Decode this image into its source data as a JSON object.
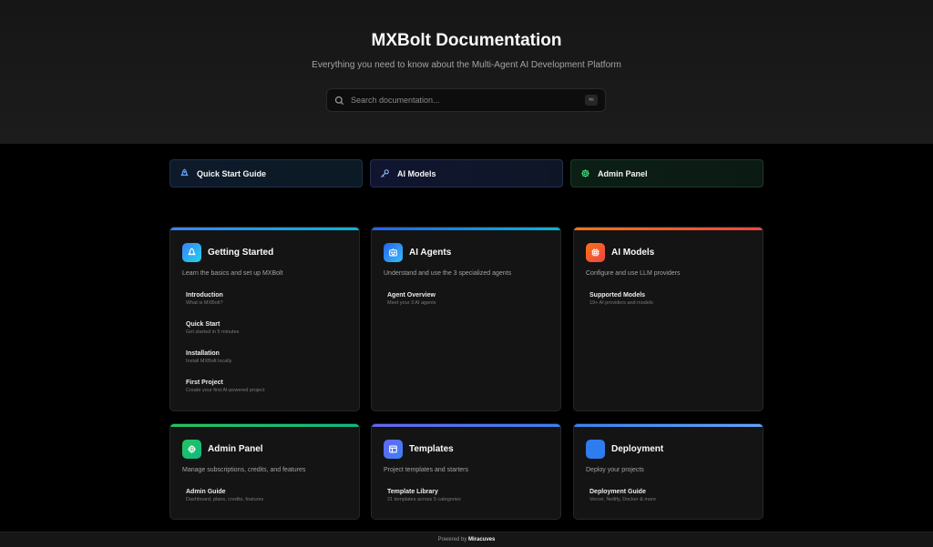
{
  "header": {
    "title": "MXBolt Documentation",
    "subtitle": "Everything you need to know about the Multi-Agent AI Development Platform"
  },
  "search": {
    "placeholder": "Search documentation...",
    "shortcut": "⌘K"
  },
  "quick_links": [
    {
      "label": "Quick Start Guide",
      "icon": "rocket-icon",
      "color": "#60a5fa"
    },
    {
      "label": "AI Models",
      "icon": "key-icon",
      "color": "#93c5fd"
    },
    {
      "label": "Admin Panel",
      "icon": "gear-icon",
      "color": "#4ade80"
    }
  ],
  "cards": [
    {
      "title": "Getting Started",
      "description": "Learn the basics and set up MXBolt",
      "icon": "rocket-icon",
      "accent": "#3b82f6",
      "items": [
        {
          "title": "Introduction",
          "subtitle": "What is MXBolt?"
        },
        {
          "title": "Quick Start",
          "subtitle": "Get started in 5 minutes"
        },
        {
          "title": "Installation",
          "subtitle": "Install MXBolt locally"
        },
        {
          "title": "First Project",
          "subtitle": "Create your first AI-powered project"
        }
      ]
    },
    {
      "title": "AI Agents",
      "description": "Understand and use the 3 specialized agents",
      "icon": "robot-icon",
      "accent": "#2563eb",
      "items": [
        {
          "title": "Agent Overview",
          "subtitle": "Meet your 3 AI agents"
        }
      ]
    },
    {
      "title": "AI Models",
      "description": "Configure and use LLM providers",
      "icon": "chip-icon",
      "accent": "#ef4444",
      "items": [
        {
          "title": "Supported Models",
          "subtitle": "19+ AI providers and models"
        }
      ]
    },
    {
      "title": "Admin Panel",
      "description": "Manage subscriptions, credits, and features",
      "icon": "gear-icon",
      "accent": "#22c55e",
      "items": [
        {
          "title": "Admin Guide",
          "subtitle": "Dashboard, plans, credits, features"
        }
      ]
    },
    {
      "title": "Templates",
      "description": "Project templates and starters",
      "icon": "template-icon",
      "accent": "#6366f1",
      "items": [
        {
          "title": "Template Library",
          "subtitle": "21 templates across 5 categories"
        }
      ]
    },
    {
      "title": "Deployment",
      "description": "Deploy your projects",
      "icon": "deploy-icon",
      "accent": "#3b82f6",
      "items": [
        {
          "title": "Deployment Guide",
          "subtitle": "Vercel, Netlify, Docker & more"
        }
      ]
    }
  ],
  "footer": {
    "prefix": "Powered by",
    "brand": "Miracuves"
  }
}
